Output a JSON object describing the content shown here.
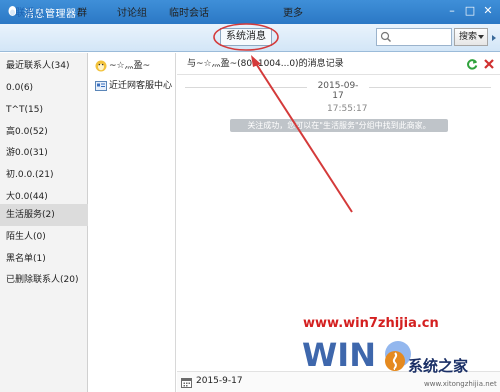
{
  "window": {
    "title": "消息管理器",
    "controls": [
      "minimize",
      "maximize",
      "close"
    ]
  },
  "nav": {
    "tabs": [
      {
        "label": "联系人",
        "active": true
      },
      {
        "label": "群",
        "active": false
      },
      {
        "label": "讨论组",
        "active": false
      },
      {
        "label": "临时会话",
        "active": false
      },
      {
        "label": "系统消息",
        "active": false
      },
      {
        "label": "更多",
        "active": false
      }
    ],
    "search_value": "",
    "search_button": "搜索"
  },
  "sidebar": {
    "items": [
      {
        "label": "最近联系人(34)",
        "selected": false
      },
      {
        "label": "0.0(6)",
        "selected": false
      },
      {
        "label": "T^T(15)",
        "selected": false
      },
      {
        "label": "高0.0(52)",
        "selected": false
      },
      {
        "label": "游0.0(31)",
        "selected": false
      },
      {
        "label": "初.0.0.(21)",
        "selected": false
      },
      {
        "label": "大0.0(44)",
        "selected": false
      },
      {
        "label": "生活服务(2)",
        "selected": true
      },
      {
        "label": "陌生人(0)",
        "selected": false
      },
      {
        "label": "黑名单(1)",
        "selected": false
      },
      {
        "label": "已删除联系人(20)",
        "selected": false
      }
    ]
  },
  "contacts": {
    "items": [
      {
        "label": "~☆灬盈~",
        "icon": "penguin-avatar-icon"
      },
      {
        "label": "近迁网客服中心",
        "icon": "service-account-icon"
      }
    ]
  },
  "main": {
    "record_title": "与~☆灬盈~(8001004...0)的消息记录",
    "date_separator": "2015-09-17",
    "message_time": "17:55:17",
    "message_text": "关注成功，您可以在\"生活服务\"分组中找到此商家。",
    "footer_date": "2015-9-17"
  },
  "watermark": {
    "url": "www.win7zhijia.cn",
    "brand": "系统之家",
    "sub": "www.xitongzhijia.net"
  },
  "colors": {
    "titlebar": "#2b78c5",
    "accent_tab": "#1f65b4",
    "annotation": "#d43a3a",
    "refresh": "#2fa23c",
    "delete": "#d03030"
  }
}
